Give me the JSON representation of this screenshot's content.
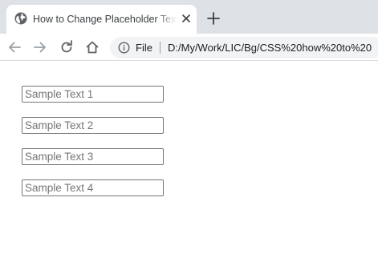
{
  "browser": {
    "tab": {
      "title": "How to Change Placeholder Text Color",
      "favicon": "globe-icon",
      "close_icon": "close-icon"
    },
    "new_tab_icon": "plus-icon",
    "toolbar": {
      "back_icon": "arrow-left-icon",
      "forward_icon": "arrow-right-icon",
      "reload_icon": "reload-icon",
      "home_icon": "home-icon"
    },
    "omnibox": {
      "info_icon": "info-icon",
      "scheme_label": "File",
      "url": "D:/My/Work/LIC/Bg/CSS%20how%20to%20"
    }
  },
  "page": {
    "fields": [
      {
        "placeholder": "Sample Text 1",
        "value": ""
      },
      {
        "placeholder": "Sample Text 2",
        "value": ""
      },
      {
        "placeholder": "Sample Text 3",
        "value": ""
      },
      {
        "placeholder": "Sample Text 4",
        "value": ""
      }
    ]
  },
  "colors": {
    "tabstrip": "#dee1e6",
    "omnibox": "#f1f3f4",
    "icon": "#5f6368",
    "placeholder_text": "#757575",
    "field_border": "#767676"
  }
}
